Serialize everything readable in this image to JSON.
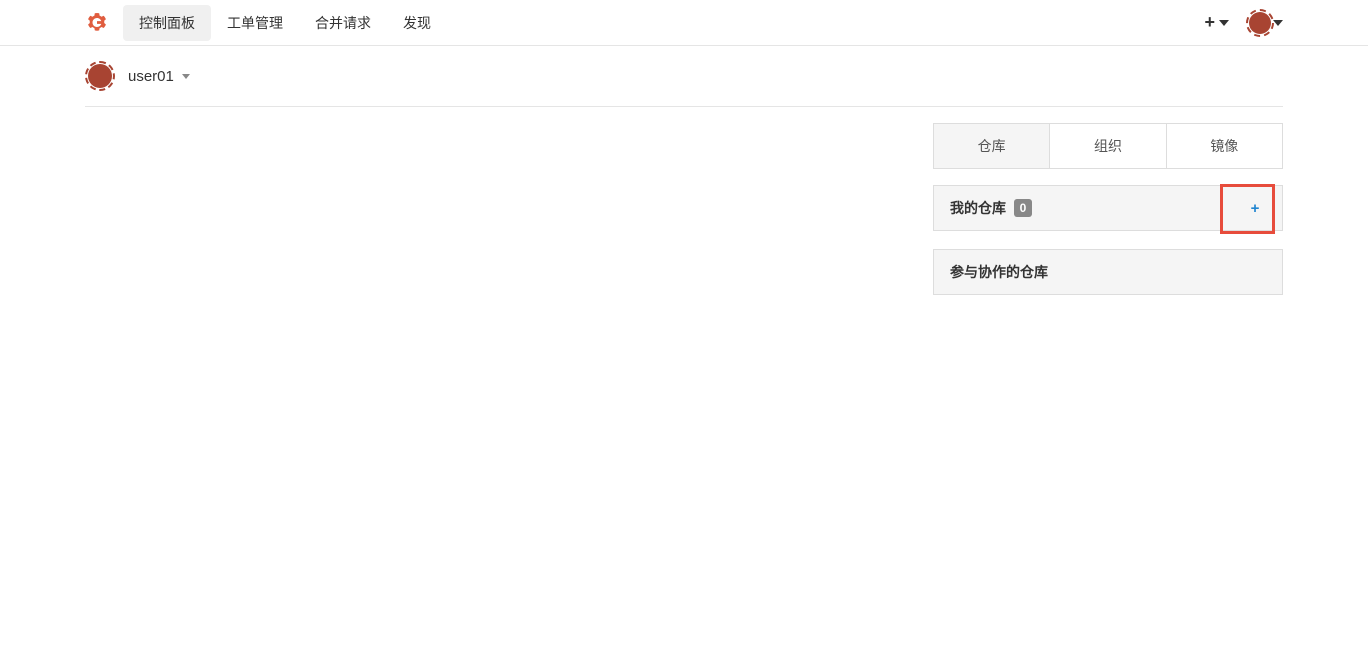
{
  "nav": {
    "items": [
      {
        "label": "控制面板",
        "active": true
      },
      {
        "label": "工单管理",
        "active": false
      },
      {
        "label": "合并请求",
        "active": false
      },
      {
        "label": "发现",
        "active": false
      }
    ]
  },
  "user": {
    "name": "user01"
  },
  "tabs": [
    {
      "label": "仓库",
      "active": true
    },
    {
      "label": "组织",
      "active": false
    },
    {
      "label": "镜像",
      "active": false
    }
  ],
  "sections": {
    "myRepos": {
      "title": "我的仓库",
      "count": "0"
    },
    "collabRepos": {
      "title": "参与协作的仓库"
    }
  }
}
